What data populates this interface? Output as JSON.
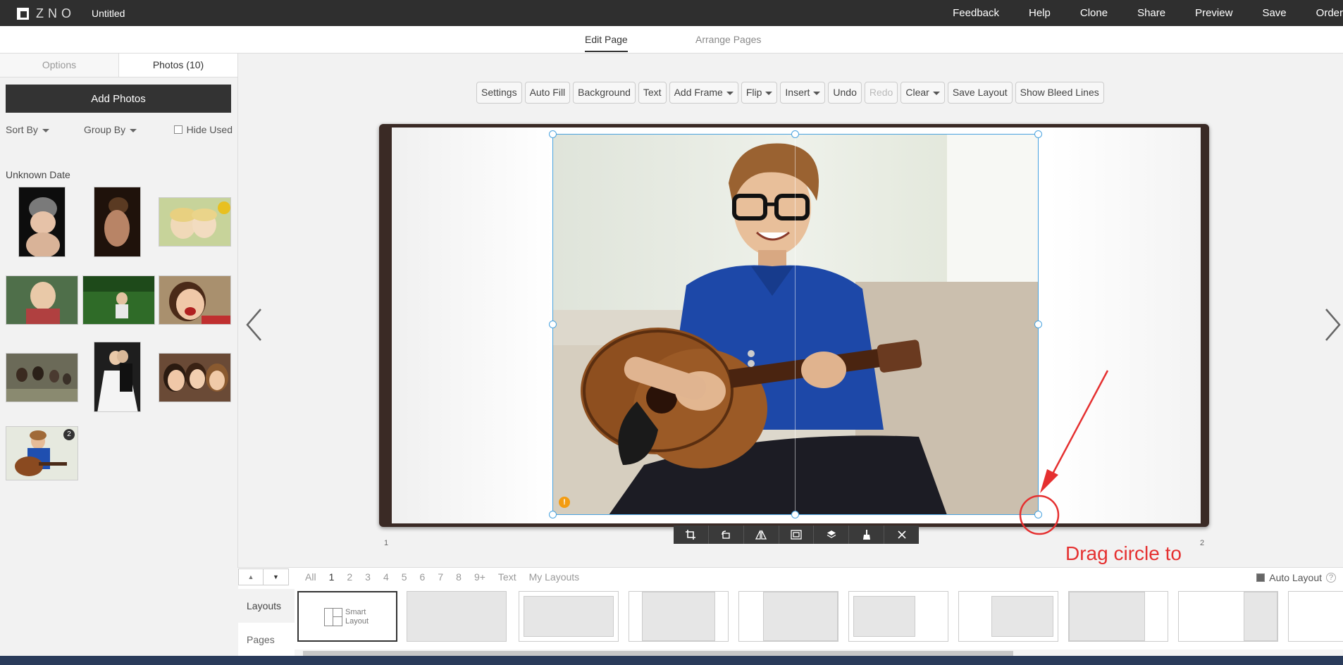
{
  "topbar": {
    "logo_text": "ZNO",
    "doc_title": "Untitled",
    "nav": [
      "Feedback",
      "Help",
      "Clone",
      "Share",
      "Preview",
      "Save",
      "Order"
    ]
  },
  "subtabs": {
    "edit_page": "Edit Page",
    "arrange_pages": "Arrange Pages"
  },
  "left_panel": {
    "tab_options": "Options",
    "tab_photos": "Photos (10)",
    "add_photos": "Add Photos",
    "sort_by": "Sort By",
    "group_by": "Group By",
    "hide_used": "Hide Used",
    "group_label": "Unknown Date",
    "photo_badge": "2"
  },
  "toolbar": {
    "settings": "Settings",
    "auto_fill": "Auto Fill",
    "background": "Background",
    "text": "Text",
    "add_frame": "Add Frame",
    "flip": "Flip",
    "insert": "Insert",
    "undo": "Undo",
    "redo": "Redo",
    "clear": "Clear",
    "save_layout": "Save Layout",
    "show_bleed_lines": "Show Bleed Lines"
  },
  "canvas": {
    "page_left_number": "1",
    "page_right_number": "2",
    "warning_glyph": "!"
  },
  "annotation": {
    "text": "Drag circle to resize frame",
    "color": "#e53030"
  },
  "bottom": {
    "filters": [
      "All",
      "1",
      "2",
      "3",
      "4",
      "5",
      "6",
      "7",
      "8",
      "9+",
      "Text",
      "My Layouts"
    ],
    "active_filter": "1",
    "auto_layout": "Auto Layout",
    "help_glyph": "?",
    "side_layouts": "Layouts",
    "side_pages": "Pages",
    "smart_layout_line1": "Smart",
    "smart_layout_line2": "Layout"
  },
  "colors": {
    "topbar": "#2f2f2f",
    "selection": "#4aa3df",
    "accent_red": "#e53030"
  }
}
